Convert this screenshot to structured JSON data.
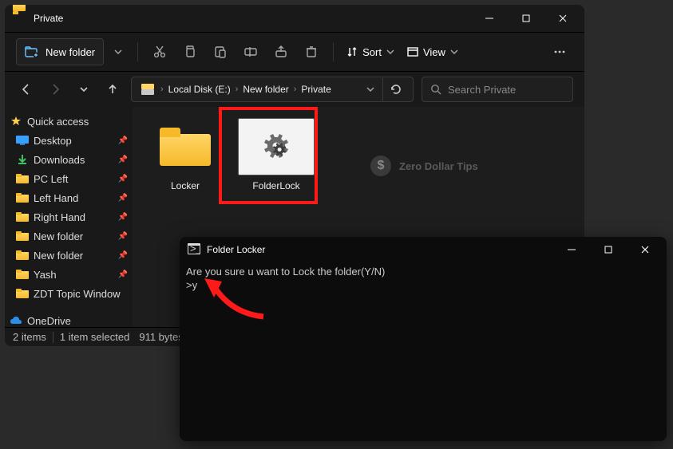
{
  "window": {
    "title": "Private"
  },
  "toolbar": {
    "new_folder_label": "New folder",
    "sort_label": "Sort",
    "view_label": "View"
  },
  "breadcrumb": {
    "segments": [
      "Local Disk (E:)",
      "New folder",
      "Private"
    ]
  },
  "search": {
    "placeholder": "Search Private"
  },
  "sidebar": {
    "quick_access": "Quick access",
    "items": [
      {
        "label": "Desktop",
        "icon": "desktop"
      },
      {
        "label": "Downloads",
        "icon": "download"
      },
      {
        "label": "PC Left",
        "icon": "folder"
      },
      {
        "label": "Left Hand",
        "icon": "folder"
      },
      {
        "label": "Right Hand",
        "icon": "folder"
      },
      {
        "label": "New folder",
        "icon": "folder"
      },
      {
        "label": "New folder",
        "icon": "folder"
      },
      {
        "label": "Yash",
        "icon": "folder"
      },
      {
        "label": "ZDT Topic Window",
        "icon": "folder"
      }
    ],
    "onedrive": "OneDrive"
  },
  "files": {
    "items": [
      {
        "label": "Locker",
        "type": "folder"
      },
      {
        "label": "FolderLock",
        "type": "batch",
        "selected": true,
        "highlighted": true
      }
    ]
  },
  "status": {
    "items_count": "2 items",
    "selection": "1 item selected",
    "size": "911 bytes"
  },
  "watermark": {
    "text": "Zero Dollar Tips",
    "glyph": "$"
  },
  "cmd": {
    "title": "Folder Locker",
    "line1": "Are you sure u want to Lock the folder(Y/N)",
    "line2": ">y"
  }
}
